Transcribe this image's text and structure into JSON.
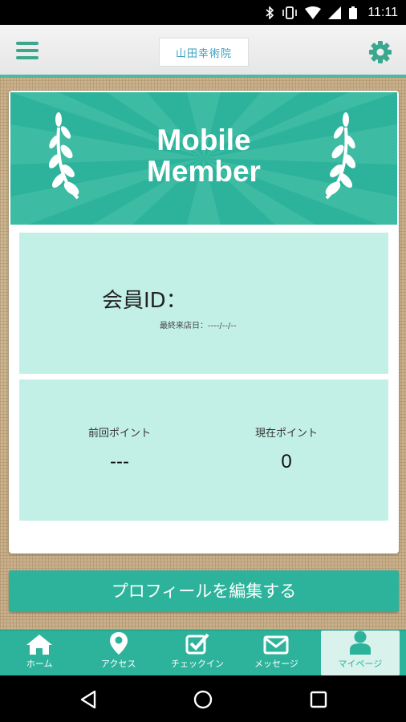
{
  "status_bar": {
    "time": "11:11"
  },
  "header": {
    "logo_text": "山田幸術院"
  },
  "banner": {
    "title_line1": "Mobile",
    "title_line2": "Member"
  },
  "member": {
    "id_label": "会員ID：",
    "last_visit_label": "最終来店日：",
    "last_visit_value": "----/--/--"
  },
  "points": {
    "previous_label": "前回ポイント",
    "previous_value": "---",
    "current_label": "現在ポイント",
    "current_value": "0"
  },
  "edit_button_label": "プロフィールを編集する",
  "tabs": [
    {
      "label": "ホーム",
      "icon": "home-icon"
    },
    {
      "label": "アクセス",
      "icon": "map-pin-icon"
    },
    {
      "label": "チェックイン",
      "icon": "checkbox-icon"
    },
    {
      "label": "メッセージ",
      "icon": "envelope-icon"
    },
    {
      "label": "マイページ",
      "icon": "person-icon",
      "active": true
    }
  ],
  "colors": {
    "accent": "#2db39b",
    "panel": "#c3f0e6",
    "icon": "#3aa88f"
  }
}
